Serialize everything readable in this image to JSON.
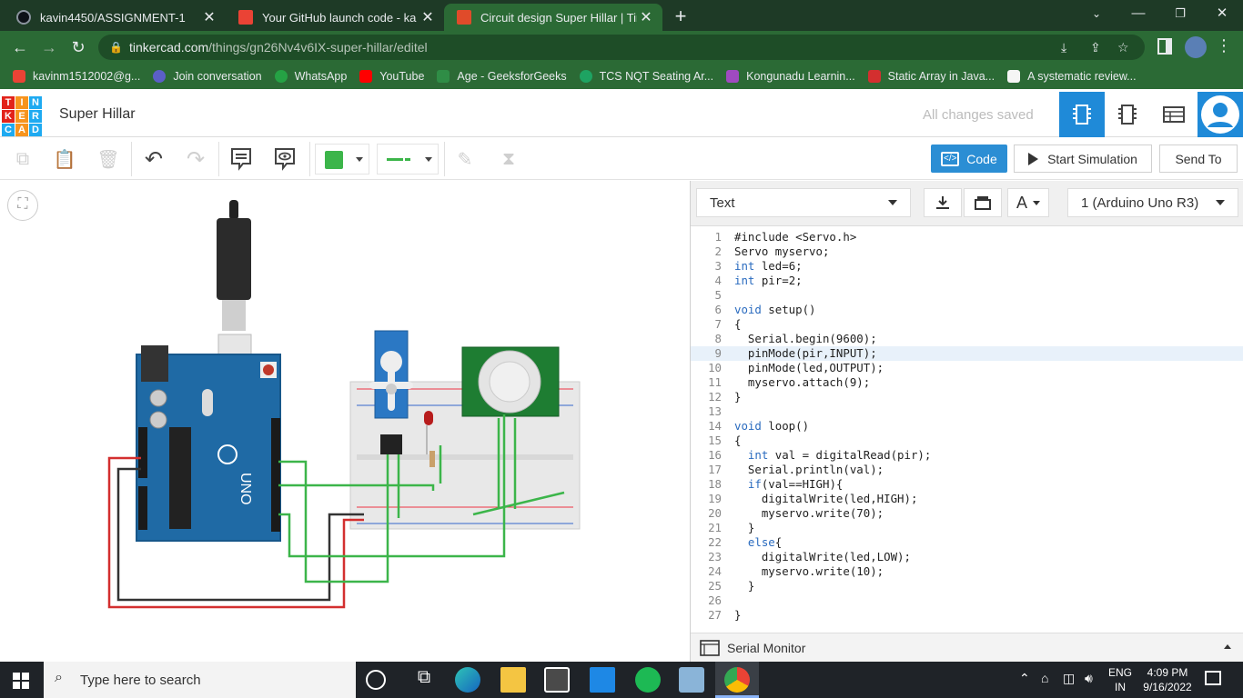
{
  "browser": {
    "tabs": [
      {
        "title": "kavin4450/ASSIGNMENT-1"
      },
      {
        "title": "Your GitHub launch code - ka"
      },
      {
        "title": "Circuit design Super Hillar | Tinke"
      }
    ],
    "url_domain": "tinkercad.com",
    "url_path": "/things/gn26Nv4v6IX-super-hillar/editel",
    "bookmarks": [
      {
        "label": "kavinm1512002@g..."
      },
      {
        "label": "Join conversation"
      },
      {
        "label": "WhatsApp"
      },
      {
        "label": "YouTube"
      },
      {
        "label": "Age - GeeksforGeeks"
      },
      {
        "label": "TCS NQT Seating Ar..."
      },
      {
        "label": "Kongunadu Learnin..."
      },
      {
        "label": "Static Array in Java..."
      },
      {
        "label": "A systematic review..."
      }
    ]
  },
  "tinkercad": {
    "logo_letters": [
      "T",
      "I",
      "N",
      "K",
      "E",
      "R",
      "C",
      "A",
      "D"
    ],
    "project_name": "Super Hillar",
    "save_status": "All changes saved",
    "code_label": "Code",
    "start_sim_label": "Start Simulation",
    "send_to_label": "Send To"
  },
  "code_panel": {
    "mode": "Text",
    "board": "1 (Arduino Uno R3)",
    "highlighted_line": 9,
    "lines": [
      "#include <Servo.h>",
      "Servo myservo;",
      "int led=6;",
      "int pir=2;",
      "",
      "void setup()",
      "{",
      "  Serial.begin(9600);",
      "  pinMode(pir,INPUT);",
      "  pinMode(led,OUTPUT);",
      "  myservo.attach(9);",
      "}",
      "",
      "void loop()",
      "{",
      "  int val = digitalRead(pir);",
      "  Serial.println(val);",
      "  if(val==HIGH){",
      "    digitalWrite(led,HIGH);",
      "    myservo.write(70);",
      "  }",
      "  else{",
      "    digitalWrite(led,LOW);",
      "    myservo.write(10);",
      "  }",
      "",
      "}"
    ],
    "serial_monitor_label": "Serial Monitor"
  },
  "taskbar": {
    "search_placeholder": "Type here to search",
    "lang_top": "ENG",
    "lang_bottom": "IN",
    "time": "4:09 PM",
    "date": "9/16/2022"
  },
  "colors": {
    "chrome_dark": "#1e3a26",
    "chrome_green": "#2b6a35",
    "code_blue": "#2b8ed4",
    "arduino_blue": "#1f6aa5",
    "fill_green": "#3cb54a"
  }
}
